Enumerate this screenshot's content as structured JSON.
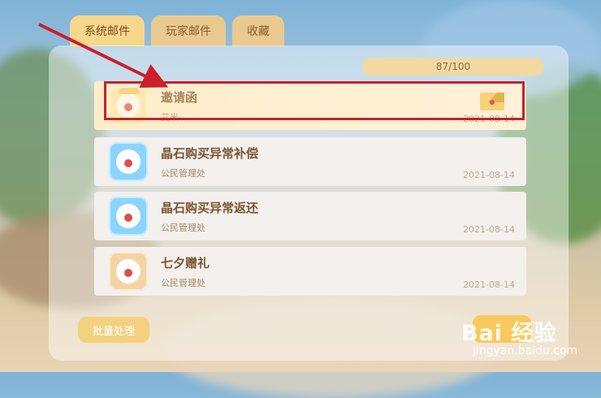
{
  "tabs": [
    {
      "label": "系统邮件",
      "active": true
    },
    {
      "label": "玩家邮件",
      "active": false
    },
    {
      "label": "收藏",
      "active": false
    }
  ],
  "capacity": "87/100",
  "mails": [
    {
      "title": "邀请函",
      "sender": "艾米",
      "date": "2021-08-14",
      "icon": "clown-hat-avatar",
      "highlighted": true,
      "envelope_icon": true
    },
    {
      "title": "晶石购买异常补偿",
      "sender": "公民管理处",
      "date": "2021-08-14",
      "icon": "clown-avatar"
    },
    {
      "title": "晶石购买异常返还",
      "sender": "公民管理处",
      "date": "2021-08-14",
      "icon": "clown-avatar"
    },
    {
      "title": "七夕赠礼",
      "sender": "公民管理处",
      "date": "2021-08-14",
      "icon": "chick-avatar"
    }
  ],
  "batch_button": "批量处理",
  "watermark": {
    "logo": "Bai 经验",
    "site": "jingyan.baidu.com"
  },
  "colors": {
    "annotation_red": "#cc1e2b",
    "tab_active": "#f6d78c",
    "button_gold": "#f3d17f"
  }
}
